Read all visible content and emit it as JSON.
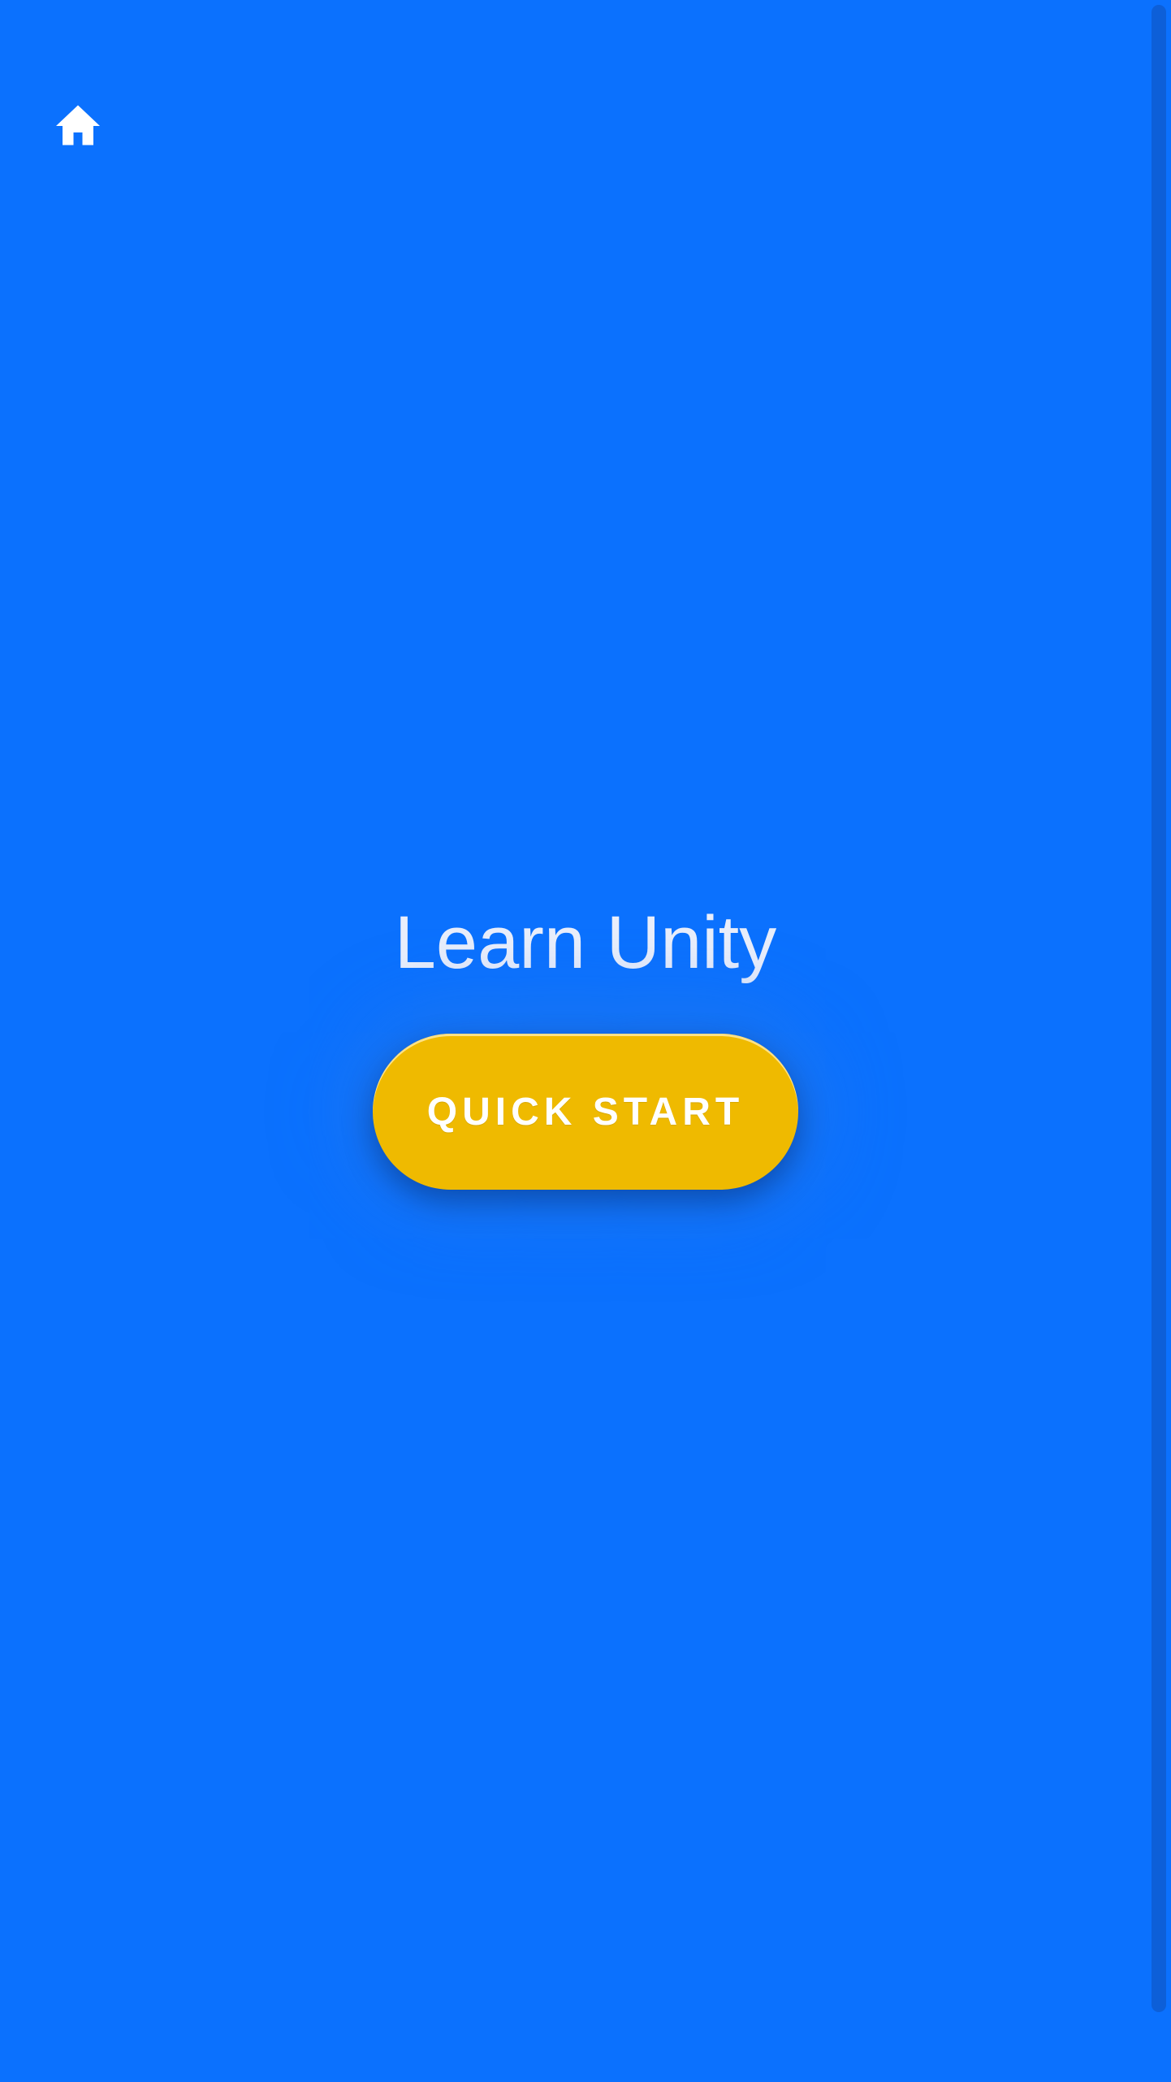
{
  "header": {
    "home_icon": "home-icon"
  },
  "main": {
    "title": "Learn Unity",
    "quick_start_label": "QUICK START"
  },
  "colors": {
    "background": "#0b71fe",
    "button": "#efba00",
    "title_text": "#e9eefb",
    "button_text": "#ffffff"
  }
}
